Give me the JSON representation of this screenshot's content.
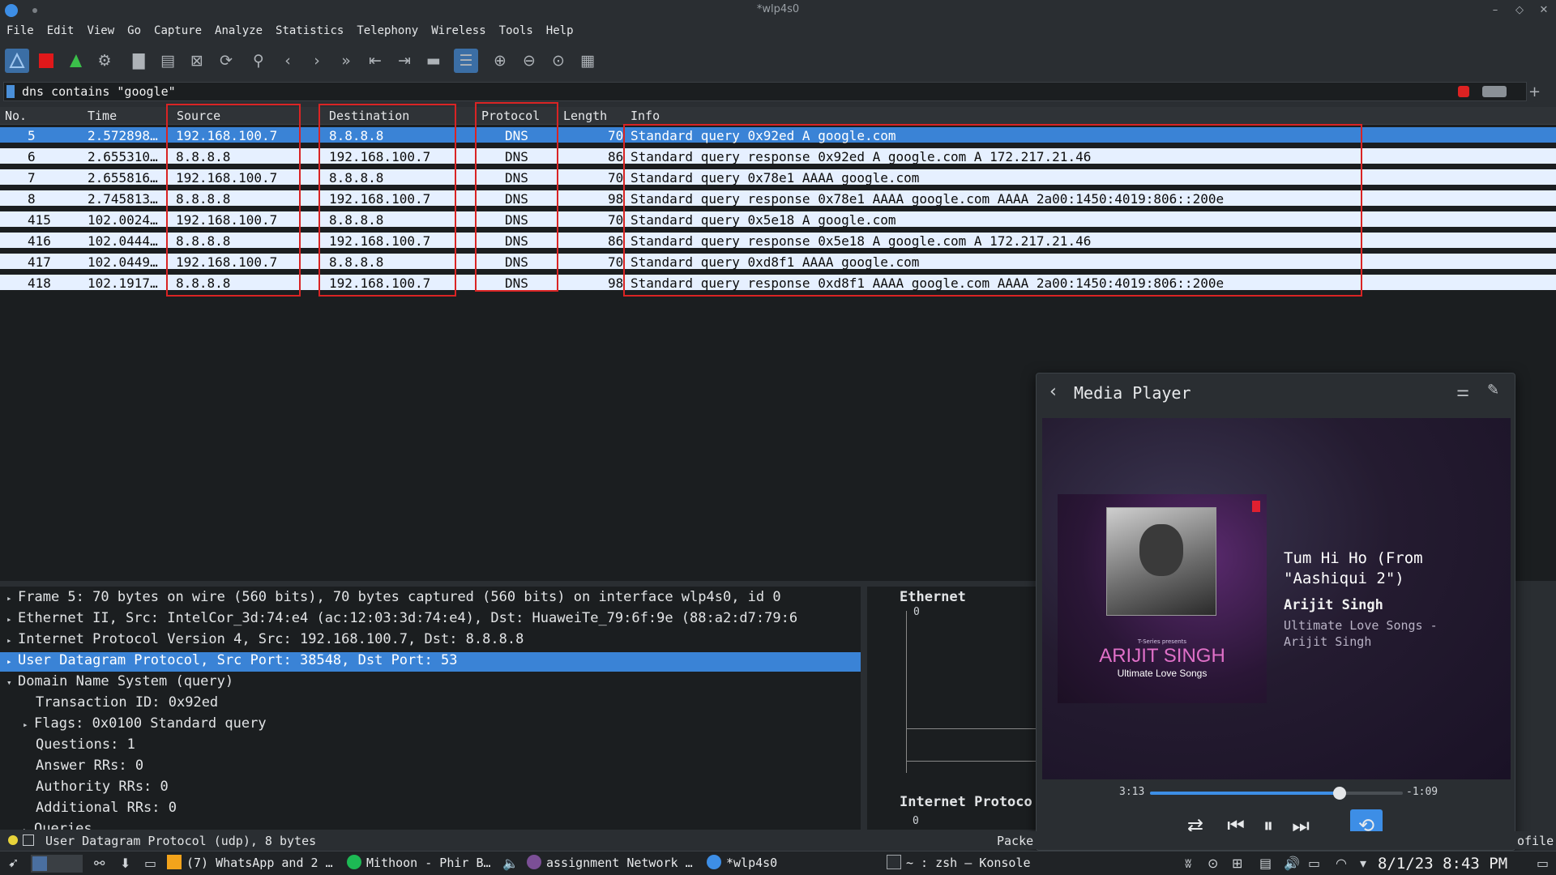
{
  "window": {
    "title": "*wlp4s0"
  },
  "menu": [
    "File",
    "Edit",
    "View",
    "Go",
    "Capture",
    "Analyze",
    "Statistics",
    "Telephony",
    "Wireless",
    "Tools",
    "Help"
  ],
  "filter": {
    "value": "dns contains \"google\""
  },
  "packet_list": {
    "columns": [
      "No.",
      "Time",
      "Source",
      "Destination",
      "Protocol",
      "Length",
      "Info"
    ],
    "rows": [
      {
        "no": "5",
        "time": "2.572898…",
        "source": "192.168.100.7",
        "destination": "8.8.8.8",
        "protocol": "DNS",
        "length": "70",
        "info": "Standard query 0x92ed A google.com"
      },
      {
        "no": "6",
        "time": "2.655310…",
        "source": "8.8.8.8",
        "destination": "192.168.100.7",
        "protocol": "DNS",
        "length": "86",
        "info": "Standard query response 0x92ed A google.com A 172.217.21.46"
      },
      {
        "no": "7",
        "time": "2.655816…",
        "source": "192.168.100.7",
        "destination": "8.8.8.8",
        "protocol": "DNS",
        "length": "70",
        "info": "Standard query 0x78e1 AAAA google.com"
      },
      {
        "no": "8",
        "time": "2.745813…",
        "source": "8.8.8.8",
        "destination": "192.168.100.7",
        "protocol": "DNS",
        "length": "98",
        "info": "Standard query response 0x78e1 AAAA google.com AAAA 2a00:1450:4019:806::200e"
      },
      {
        "no": "415",
        "time": "102.0024…",
        "source": "192.168.100.7",
        "destination": "8.8.8.8",
        "protocol": "DNS",
        "length": "70",
        "info": "Standard query 0x5e18 A google.com"
      },
      {
        "no": "416",
        "time": "102.0444…",
        "source": "8.8.8.8",
        "destination": "192.168.100.7",
        "protocol": "DNS",
        "length": "86",
        "info": "Standard query response 0x5e18 A google.com A 172.217.21.46"
      },
      {
        "no": "417",
        "time": "102.0449…",
        "source": "192.168.100.7",
        "destination": "8.8.8.8",
        "protocol": "DNS",
        "length": "70",
        "info": "Standard query 0xd8f1 AAAA google.com"
      },
      {
        "no": "418",
        "time": "102.1917…",
        "source": "8.8.8.8",
        "destination": "192.168.100.7",
        "protocol": "DNS",
        "length": "98",
        "info": "Standard query response 0xd8f1 AAAA google.com AAAA 2a00:1450:4019:806::200e"
      }
    ]
  },
  "details": [
    {
      "text": "Frame 5: 70 bytes on wire (560 bits), 70 bytes captured (560 bits) on interface wlp4s0, id 0",
      "arrow": "▸",
      "selected": false
    },
    {
      "text": "Ethernet II, Src: IntelCor_3d:74:e4 (ac:12:03:3d:74:e4), Dst: HuaweiTe_79:6f:9e (88:a2:d7:79:6",
      "arrow": "▸",
      "selected": false
    },
    {
      "text": "Internet Protocol Version 4, Src: 192.168.100.7, Dst: 8.8.8.8",
      "arrow": "▸",
      "selected": false
    },
    {
      "text": "User Datagram Protocol, Src Port: 38548, Dst Port: 53",
      "arrow": "▸",
      "selected": true
    },
    {
      "text": "Domain Name System (query)",
      "arrow": "▾",
      "selected": false
    },
    {
      "text": "Transaction ID: 0x92ed",
      "arrow": "",
      "selected": false
    },
    {
      "text": "Flags: 0x0100 Standard query",
      "arrow": "▸",
      "selected": false
    },
    {
      "text": "Questions: 1",
      "arrow": "",
      "selected": false
    },
    {
      "text": "Answer RRs: 0",
      "arrow": "",
      "selected": false
    },
    {
      "text": "Authority RRs: 0",
      "arrow": "",
      "selected": false
    },
    {
      "text": "Additional RRs: 0",
      "arrow": "",
      "selected": false
    },
    {
      "text": "Queries",
      "arrow": "▸",
      "selected": false
    }
  ],
  "bytes_pane": {
    "label1": "Ethernet",
    "label2": "Internet Protoco",
    "tick": "0"
  },
  "media_player": {
    "title": "Media Player",
    "cover_presents": "T-Series presents",
    "cover_name": "ARIJIT SINGH",
    "cover_sub": "Ultimate Love Songs",
    "song": "Tum Hi Ho (From \"Aashiqui 2\")",
    "artist": "Arijit Singh",
    "album": "Ultimate Love Songs - Arijit Singh",
    "elapsed": "3:13",
    "remaining": "-1:09",
    "progress": 0.75
  },
  "status": {
    "message": "User Datagram Protocol (udp), 8 bytes",
    "packets": "Packe",
    "profile": "ofile"
  },
  "taskbar": {
    "tasks": [
      "(7) WhatsApp and 2 …",
      "Mithoon - Phir B…",
      "assignment Network …",
      "*wlp4s0",
      "~ : zsh — Konsole"
    ],
    "clock": "8/1/23  8:43 PM"
  },
  "colors": {
    "selection": "#3a83d6",
    "row_bg": "#e6f0ff",
    "highlight_box": "#d92424",
    "accent": "#3d8ee6"
  }
}
